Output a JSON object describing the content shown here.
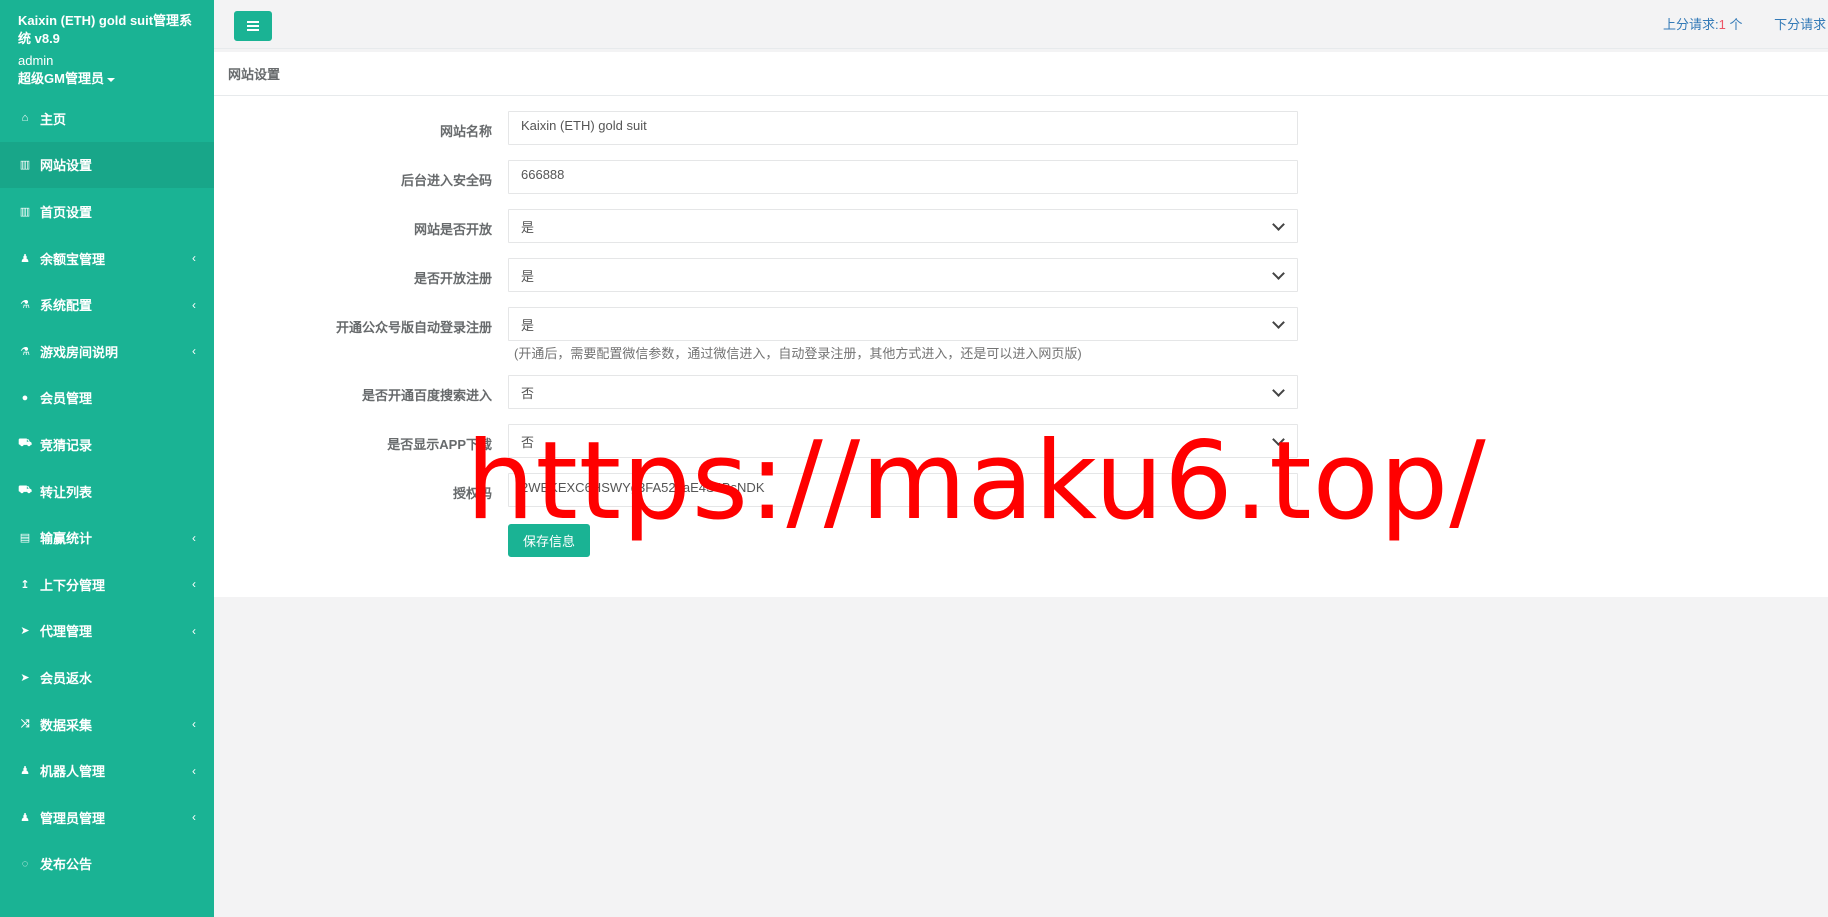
{
  "brand": {
    "title": "Kaixin (ETH) gold suit管理系统 v8.9",
    "user": "admin",
    "role": "超级GM管理员"
  },
  "sidebar": {
    "items": [
      {
        "label": "主页",
        "icon": "home-icon",
        "arrow": false,
        "active": false
      },
      {
        "label": "网站设置",
        "icon": "columns-icon",
        "arrow": false,
        "active": true
      },
      {
        "label": "首页设置",
        "icon": "columns-icon",
        "arrow": false,
        "active": false
      },
      {
        "label": "余额宝管理",
        "icon": "male-icon",
        "arrow": true,
        "active": false
      },
      {
        "label": "系统配置",
        "icon": "flask-icon",
        "arrow": true,
        "active": false
      },
      {
        "label": "游戏房间说明",
        "icon": "flask-icon",
        "arrow": true,
        "active": false
      },
      {
        "label": "会员管理",
        "icon": "user-icon",
        "arrow": false,
        "active": false
      },
      {
        "label": "竞猜记录",
        "icon": "car-icon",
        "arrow": false,
        "active": false
      },
      {
        "label": "转让列表",
        "icon": "car-icon",
        "arrow": false,
        "active": false
      },
      {
        "label": "输赢统计",
        "icon": "bar-chart-icon",
        "arrow": true,
        "active": false
      },
      {
        "label": "上下分管理",
        "icon": "level-up-icon",
        "arrow": true,
        "active": false
      },
      {
        "label": "代理管理",
        "icon": "paper-plane-icon",
        "arrow": true,
        "active": false
      },
      {
        "label": "会员返水",
        "icon": "paper-plane-icon",
        "arrow": false,
        "active": false
      },
      {
        "label": "数据采集",
        "icon": "random-icon",
        "arrow": true,
        "active": false
      },
      {
        "label": "机器人管理",
        "icon": "male-icon",
        "arrow": true,
        "active": false
      },
      {
        "label": "管理员管理",
        "icon": "male-icon",
        "arrow": true,
        "active": false
      },
      {
        "label": "发布公告",
        "icon": "comment-icon",
        "arrow": false,
        "active": false
      }
    ]
  },
  "topbar": {
    "up_label": "上分请求:",
    "up_count": "1",
    "up_unit": " 个",
    "down_label": "下分请求"
  },
  "panel": {
    "title": "网站设置"
  },
  "form": {
    "site_name_label": "网站名称",
    "site_name_value": "Kaixin (ETH) gold suit",
    "security_code_label": "后台进入安全码",
    "security_code_value": "666888",
    "site_open_label": "网站是否开放",
    "site_open_value": "是",
    "register_open_label": "是否开放注册",
    "register_open_value": "是",
    "wechat_auto_label": "开通公众号版自动登录注册",
    "wechat_auto_value": "是",
    "wechat_auto_help": "(开通后，需要配置微信参数，通过微信进入，自动登录注册，其他方式进入，还是可以进入网页版)",
    "baidu_label": "是否开通百度搜索进入",
    "baidu_value": "否",
    "app_download_label": "是否显示APP下载",
    "app_download_value": "否",
    "auth_code_label": "授权码",
    "auth_code_value": "2WEKEXC6HSWYg3FA527aE4S4BsNDK",
    "save_label": "保存信息"
  },
  "watermark": "https://maku6.top/",
  "colors": {
    "sidebar": "#1ab394",
    "active": "#18a689",
    "link": "#337ab7",
    "badge": "#ed5565",
    "watermark": "#ff0000"
  }
}
